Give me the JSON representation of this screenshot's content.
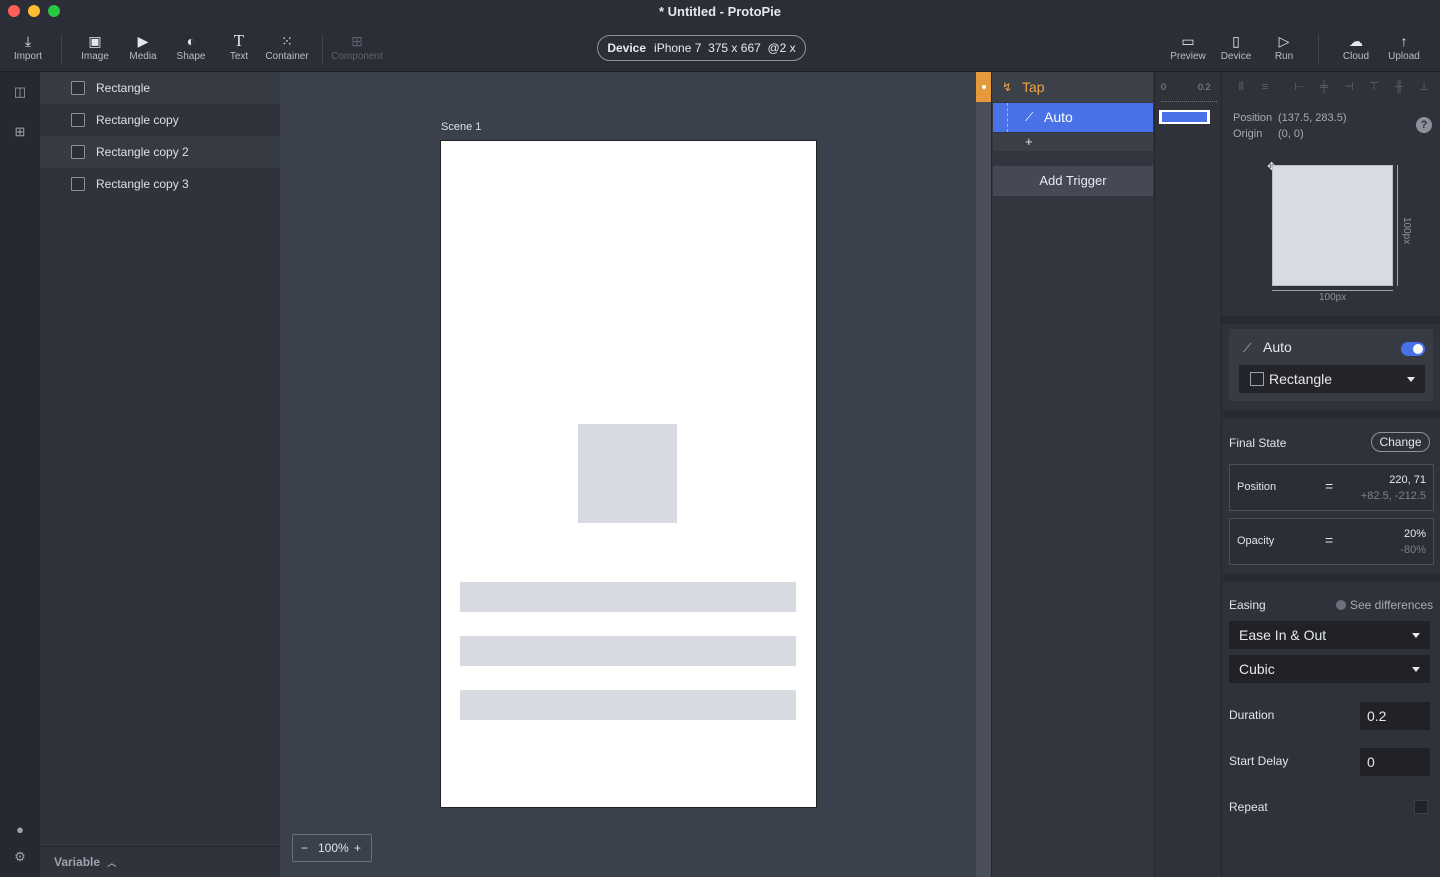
{
  "window": {
    "title": "* Untitled - ProtoPie"
  },
  "toolbar": {
    "import": "Import",
    "image": "Image",
    "media": "Media",
    "shape": "Shape",
    "text": "Text",
    "container": "Container",
    "component": "Component",
    "preview": "Preview",
    "device": "Device",
    "run": "Run",
    "cloud": "Cloud",
    "upload": "Upload"
  },
  "device_selector": {
    "label": "Device",
    "model": "iPhone 7",
    "size": "375 x 667",
    "scale": "@2 x"
  },
  "layers": [
    {
      "name": "Rectangle"
    },
    {
      "name": "Rectangle copy"
    },
    {
      "name": "Rectangle copy 2"
    },
    {
      "name": "Rectangle copy 3"
    }
  ],
  "variable_label": "Variable",
  "canvas": {
    "scene_label": "Scene 1",
    "zoom": "100%",
    "zoom_out": "−",
    "zoom_in": "+"
  },
  "interactions": {
    "trigger": "Tap",
    "response": "Auto",
    "add_response": "+",
    "add_trigger": "Add Trigger",
    "timeline_start": "0",
    "timeline_end": "0.2"
  },
  "properties": {
    "position_label": "Position",
    "position_value": "(137.5, 283.5)",
    "origin_label": "Origin",
    "origin_value": "(0, 0)",
    "help": "?",
    "width_label": "100px",
    "height_label": "100px",
    "response_title": "Auto",
    "response_enabled": true,
    "target_layer": "Rectangle",
    "final_state_label": "Final State",
    "change_button": "Change",
    "position_state": {
      "name": "Position",
      "operator": "=",
      "value": "220, 71",
      "delta": "+82.5, -212.5"
    },
    "opacity_state": {
      "name": "Opacity",
      "operator": "=",
      "value": "20%",
      "delta": "-80%"
    },
    "easing_label": "Easing",
    "see_differences": "See differences",
    "easing_value": "Ease In & Out",
    "easing_curve": "Cubic",
    "duration_label": "Duration",
    "duration_value": "0.2",
    "start_delay_label": "Start Delay",
    "start_delay_value": "0",
    "repeat_label": "Repeat"
  },
  "colors": {
    "accent": "#4a72e8",
    "trigger": "#f0a445"
  }
}
